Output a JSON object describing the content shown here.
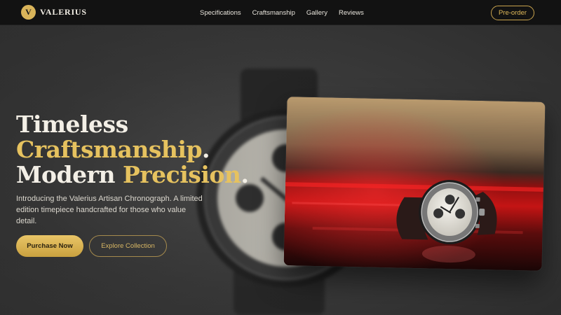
{
  "nav": {
    "logo_letter": "V",
    "brand": "VALERIUS",
    "links": [
      "Specifications",
      "Craftsmanship",
      "Gallery",
      "Reviews"
    ],
    "cta": "Pre-order"
  },
  "hero": {
    "headline": {
      "line1": "Timeless",
      "line2_gold": "Craftsmanship",
      "line2_end": ".",
      "line3_white": "Modern ",
      "line3_gold": "Precision",
      "line3_end": "."
    },
    "intro": "Introducing the Valerius Artisan Chronograph. A limited edition timepiece handcrafted for those who value detail.",
    "primary_button": "Purchase Now",
    "secondary_button": "Explore Collection"
  },
  "colors": {
    "accent_gold": "#e6c25f",
    "nav_bg": "#121212",
    "page_bg": "#2e2e2e",
    "card_red": "#c41414"
  },
  "icons": {
    "logo_badge": "monogram-v-badge",
    "background_image": "blurred-watch-image",
    "card_image": "watch-on-red-surface-photo"
  }
}
